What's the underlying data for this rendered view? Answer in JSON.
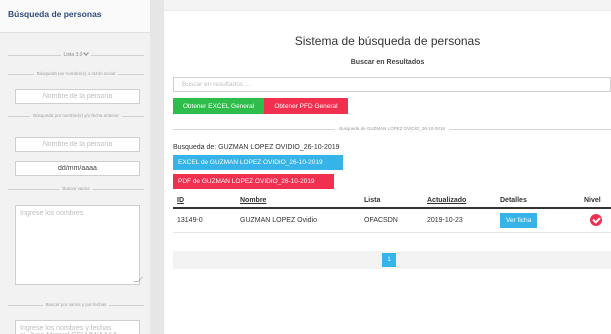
{
  "sidebar": {
    "title": "Búsqueda de personas",
    "lista_toggle": "Lista 3.0",
    "section_name": "Búsqueda por nombre(s) o razón social",
    "name_placeholder": "Nombre de la persona",
    "section_name_date": "Búsqueda por nombre(s) y/o fecha anterior",
    "name_date_placeholder": "Nombre de la persona",
    "date_value": "dd/mm/aaaa",
    "section_multi": "Buscar varios",
    "multi_placeholder": "Ingrese los nombres",
    "section_multi_dates": "Buscar por varios y por fechas",
    "multi_dates_placeholder": "Ingrese los nombres y fechas\nej. Juan Manuel OFLMM/AAAA"
  },
  "main": {
    "title": "Sistema de búsqueda de personas",
    "search_subtitle": "Buscar en Resultados",
    "search_placeholder": "Buscar en resultados ...",
    "excel_general_label": "Obtener EXCEL General",
    "pdf_general_label": "Obtener PFD General",
    "search_rule_label": "Busqueda de GUZMAN LOPEZ OVIDIO_26-10-2019",
    "busqueda_text": "Busqueda de: GUZMAN LOPEZ OVIDIO_26-10-2019",
    "excel_person_label": "EXCEL de GUZMAN LOPEZ OVIDIO_26-10-2019",
    "pdf_person_label": "PDF de GUZMAN LOPEZ OVIDIO_26-10-2019"
  },
  "table": {
    "headers": [
      "ID",
      "Nombre",
      "Lista",
      "Actualizado",
      "Detalles",
      "Nivel"
    ],
    "rows": [
      {
        "id": "13149-0",
        "nombre": "GUZMAN LOPEZ Ovidio",
        "lista": "OFACSDN",
        "actualizado": "2019-10-23",
        "detalles_label": "Ver ficha",
        "nivel_icon": "check-circle-icon"
      }
    ]
  },
  "pagination": {
    "current_page": "1"
  },
  "colors": {
    "green": "#2ebd4a",
    "red": "#f0304e",
    "blue": "#36b3e8",
    "sidebar_title": "#2e4d7a"
  }
}
